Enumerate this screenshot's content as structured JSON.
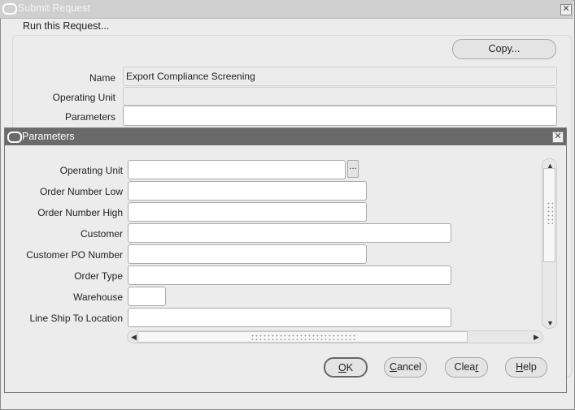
{
  "outer_window": {
    "title": "Submit Request",
    "group_label": "Run this Request...",
    "copy_label": "Copy...",
    "fields": {
      "name": {
        "label": "Name",
        "value": "Export Compliance Screening"
      },
      "operating_unit": {
        "label": "Operating Unit",
        "value": ""
      },
      "parameters": {
        "label": "Parameters",
        "value": ""
      }
    }
  },
  "param_window": {
    "title": "Parameters",
    "fields": [
      {
        "label": "Operating Unit",
        "value": ""
      },
      {
        "label": "Order Number Low",
        "value": ""
      },
      {
        "label": "Order Number High",
        "value": ""
      },
      {
        "label": "Customer",
        "value": ""
      },
      {
        "label": "Customer PO Number",
        "value": ""
      },
      {
        "label": "Order Type",
        "value": ""
      },
      {
        "label": "Warehouse",
        "value": ""
      },
      {
        "label": "Line Ship To Location",
        "value": ""
      }
    ],
    "lov_button": "...",
    "buttons": {
      "ok": {
        "accel": "O",
        "rest": "K"
      },
      "cancel": {
        "accel": "C",
        "rest": "ancel"
      },
      "clear": {
        "accel": "",
        "rest": "Clear",
        "accel2": "r",
        "pre": "Clea"
      },
      "help": {
        "accel": "H",
        "rest": "elp"
      }
    }
  },
  "icons": {
    "window_icon": "oracle-logo-icon",
    "close": "close-icon",
    "scroll_up": "arrow-up-icon",
    "scroll_down": "arrow-down-icon",
    "scroll_left": "arrow-left-icon",
    "scroll_right": "arrow-right-icon"
  }
}
